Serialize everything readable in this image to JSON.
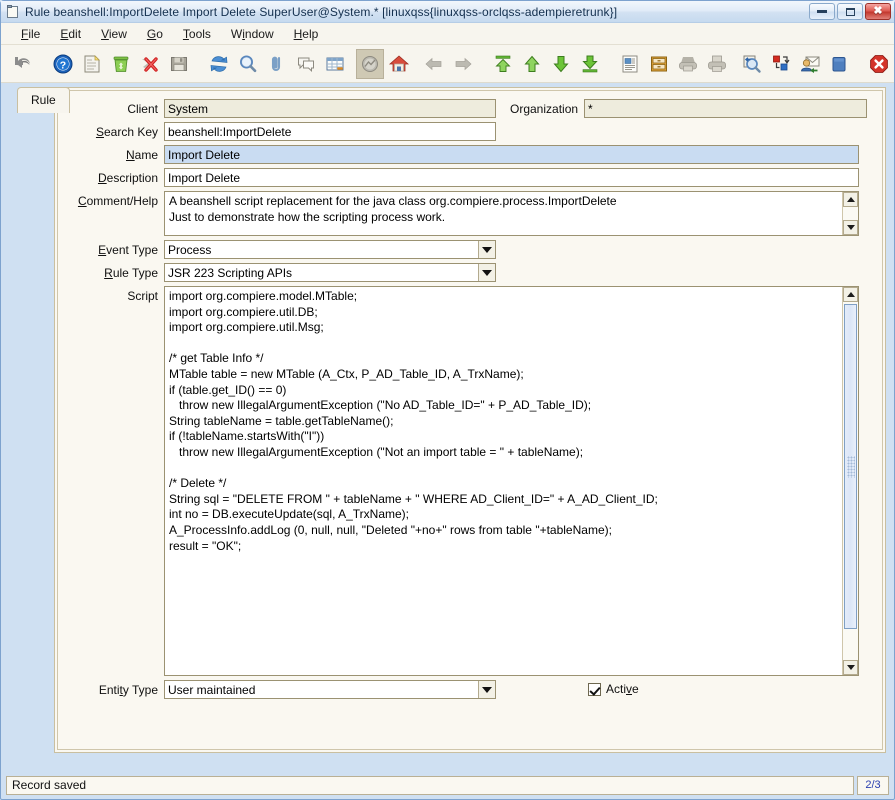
{
  "window": {
    "title": "Rule  beanshell:ImportDelete  Import Delete  SuperUser@System.*  [linuxqss{linuxqss-orclqss-adempieretrunk}]",
    "icon": "window-sheet-icon",
    "minimize_label": "–",
    "maximize_label": "□",
    "close_label": "✕"
  },
  "menubar": {
    "items": [
      {
        "label": "File",
        "mnemonic": "F"
      },
      {
        "label": "Edit",
        "mnemonic": "E"
      },
      {
        "label": "View",
        "mnemonic": "V"
      },
      {
        "label": "Go",
        "mnemonic": "G"
      },
      {
        "label": "Tools",
        "mnemonic": "T"
      },
      {
        "label": "Window",
        "mnemonic": "W"
      },
      {
        "label": "Help",
        "mnemonic": "H"
      }
    ]
  },
  "toolbar": {
    "items": [
      {
        "name": "undo-icon",
        "title": "Undo"
      },
      {
        "name": "help-icon",
        "title": "Help"
      },
      {
        "name": "new-record-icon",
        "title": "New Record"
      },
      {
        "name": "delete-icon",
        "title": "Delete"
      },
      {
        "name": "delete-selection-icon",
        "title": "Delete Selection"
      },
      {
        "name": "save-icon",
        "title": "Save"
      },
      {
        "name": "refresh-icon",
        "title": "Refresh"
      },
      {
        "name": "find-icon",
        "title": "Find"
      },
      {
        "name": "attachment-icon",
        "title": "Attachment"
      },
      {
        "name": "chat-icon",
        "title": "Chat"
      },
      {
        "name": "grid-toggle-icon",
        "title": "Grid Toggle"
      },
      {
        "name": "history-icon",
        "title": "History Records"
      },
      {
        "name": "home-icon",
        "title": "Home"
      },
      {
        "name": "parent-record-icon",
        "title": "Parent Record"
      },
      {
        "name": "detail-record-icon",
        "title": "Detail Record"
      },
      {
        "name": "first-record-icon",
        "title": "First Record"
      },
      {
        "name": "previous-record-icon",
        "title": "Previous Record"
      },
      {
        "name": "next-record-icon",
        "title": "Next Record"
      },
      {
        "name": "last-record-icon",
        "title": "Last Record"
      },
      {
        "name": "report-icon",
        "title": "Report"
      },
      {
        "name": "archive-icon",
        "title": "Archived Documents"
      },
      {
        "name": "print-preview-icon",
        "title": "Print Preview"
      },
      {
        "name": "print-icon",
        "title": "Print"
      },
      {
        "name": "zoom-across-icon",
        "title": "Zoom Across"
      },
      {
        "name": "active-workflow-icon",
        "title": "Active Workflow"
      },
      {
        "name": "requests-icon",
        "title": "Requests"
      },
      {
        "name": "product-info-icon",
        "title": "Product Info"
      },
      {
        "name": "exit-icon",
        "title": "Exit"
      }
    ]
  },
  "tabs": [
    {
      "label": "Rule",
      "selected": true
    }
  ],
  "form": {
    "client": {
      "label": "Client",
      "value": "System",
      "readonly": true
    },
    "organization": {
      "label": "Organization",
      "value": "*",
      "readonly": true
    },
    "search_key": {
      "label": "Search Key",
      "mnemonic": "S",
      "value": "beanshell:ImportDelete"
    },
    "name": {
      "label": "Name",
      "mnemonic": "N",
      "value": "Import Delete",
      "highlighted": true
    },
    "description": {
      "label": "Description",
      "mnemonic": "D",
      "value": "Import Delete"
    },
    "comment_help": {
      "label": "Comment/Help",
      "mnemonic": "C",
      "value": "A beanshell script replacement for the java class org.compiere.process.ImportDelete\nJust to demonstrate how the scripting process work."
    },
    "event_type": {
      "label": "Event Type",
      "mnemonic": "E",
      "value": "Process"
    },
    "rule_type": {
      "label": "Rule Type",
      "mnemonic": "R",
      "value": "JSR 223 Scripting APIs"
    },
    "script": {
      "label": "Script",
      "value": "import org.compiere.model.MTable;\nimport org.compiere.util.DB;\nimport org.compiere.util.Msg;\n\n/* get Table Info */\nMTable table = new MTable (A_Ctx, P_AD_Table_ID, A_TrxName);\nif (table.get_ID() == 0)\n   throw new IllegalArgumentException (\"No AD_Table_ID=\" + P_AD_Table_ID);\nString tableName = table.getTableName();\nif (!tableName.startsWith(\"I\"))\n   throw new IllegalArgumentException (\"Not an import table = \" + tableName);\n\n/* Delete */\nString sql = \"DELETE FROM \" + tableName + \" WHERE AD_Client_ID=\" + A_AD_Client_ID;\nint no = DB.executeUpdate(sql, A_TrxName);\nA_ProcessInfo.addLog (0, null, null, \"Deleted \"+no+\" rows from table \"+tableName);\nresult = \"OK\";"
    },
    "entity_type": {
      "label": "Entity Type",
      "mnemonic": "T",
      "value": "User maintained"
    },
    "active": {
      "label": "Active",
      "checked": true
    }
  },
  "statusbar": {
    "message": "Record saved",
    "record_count": "2/3"
  },
  "colors": {
    "window_frame": "#7da2ce",
    "panel_bg": "#faf8f1",
    "readonly_field": "#eeecdd",
    "highlight_field": "#c9dcf2",
    "accent_text": "#2a3fb0",
    "border": "#9b9272"
  }
}
